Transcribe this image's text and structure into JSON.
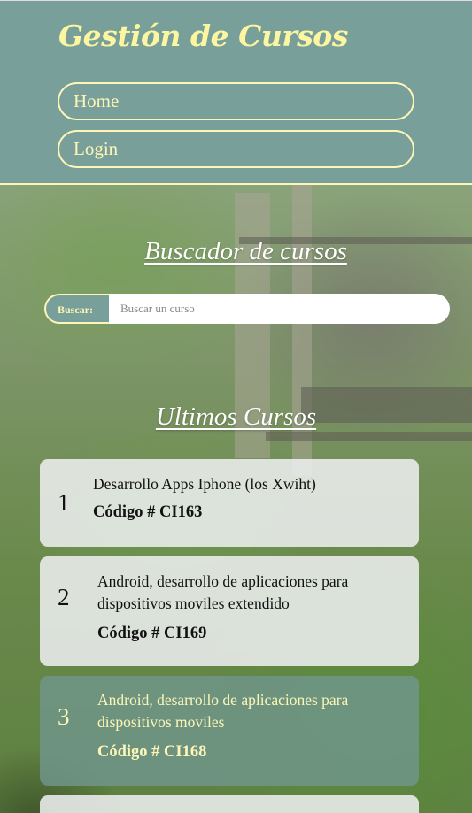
{
  "header": {
    "brand": "Gestión de Cursos",
    "nav": [
      "Home",
      "Login"
    ]
  },
  "search": {
    "title": "Buscador de cursos",
    "label": "Buscar:",
    "placeholder": "Buscar un curso"
  },
  "latest": {
    "title": "Ultimos Cursos",
    "courses": [
      {
        "num": "1",
        "name": "Desarrollo Apps Iphone (los Xwiht)",
        "code": "Código # CI163"
      },
      {
        "num": "2",
        "name": "Android, desarrollo de aplicaciones para dispositivos moviles extendido",
        "code": "Código # CI169"
      },
      {
        "num": "3",
        "name": "Android, desarrollo de aplicaciones para dispositivos moviles",
        "code": "Código # CI168"
      }
    ]
  },
  "colors": {
    "header_bg": "#789f99",
    "accent": "#fdf6b7"
  }
}
